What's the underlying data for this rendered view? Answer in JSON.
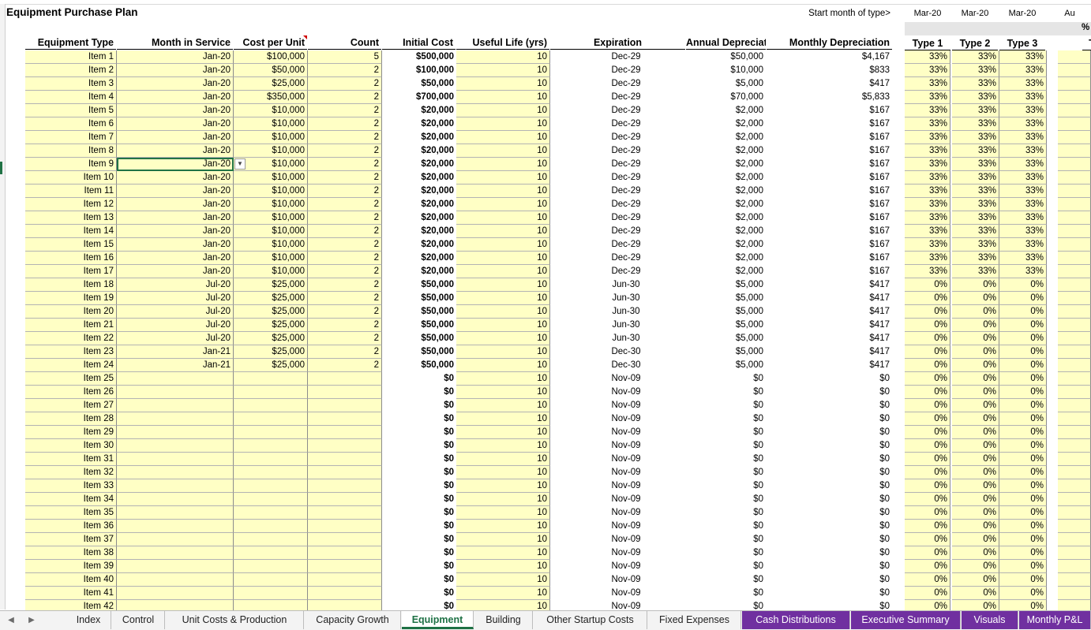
{
  "sheet": {
    "title": "Equipment Purchase Plan",
    "start_month_label": "Start month of type>",
    "start_months": [
      "Mar-20",
      "Mar-20",
      "Mar-20",
      "Au"
    ],
    "percent_label": "%",
    "headers": {
      "equipment_type": "Equipment Type",
      "month_in_service": "Month in Service",
      "cost_per_unit": "Cost per Unit",
      "count": "Count",
      "initial_cost": "Initial Cost",
      "useful_life": "Useful Life (yrs)",
      "expiration": "Expiration",
      "annual_depreciation": "Annual Depreciation",
      "monthly_depreciation": "Monthly Depreciation",
      "type1": "Type 1",
      "type2": "Type 2",
      "type3": "Type 3",
      "type4": "Ty"
    },
    "active_cell": "Month in Service, Item 9",
    "rows": [
      {
        "name": "Item 1",
        "month": "Jan-20",
        "cost": "$100,000",
        "count": "5",
        "initial": "$500,000",
        "life": "10",
        "exp": "Dec-29",
        "annual": "$50,000",
        "monthly": "$4,167",
        "t1": "33%",
        "t2": "33%",
        "t3": "33%"
      },
      {
        "name": "Item 2",
        "month": "Jan-20",
        "cost": "$50,000",
        "count": "2",
        "initial": "$100,000",
        "life": "10",
        "exp": "Dec-29",
        "annual": "$10,000",
        "monthly": "$833",
        "t1": "33%",
        "t2": "33%",
        "t3": "33%"
      },
      {
        "name": "Item 3",
        "month": "Jan-20",
        "cost": "$25,000",
        "count": "2",
        "initial": "$50,000",
        "life": "10",
        "exp": "Dec-29",
        "annual": "$5,000",
        "monthly": "$417",
        "t1": "33%",
        "t2": "33%",
        "t3": "33%"
      },
      {
        "name": "Item 4",
        "month": "Jan-20",
        "cost": "$350,000",
        "count": "2",
        "initial": "$700,000",
        "life": "10",
        "exp": "Dec-29",
        "annual": "$70,000",
        "monthly": "$5,833",
        "t1": "33%",
        "t2": "33%",
        "t3": "33%"
      },
      {
        "name": "Item 5",
        "month": "Jan-20",
        "cost": "$10,000",
        "count": "2",
        "initial": "$20,000",
        "life": "10",
        "exp": "Dec-29",
        "annual": "$2,000",
        "monthly": "$167",
        "t1": "33%",
        "t2": "33%",
        "t3": "33%"
      },
      {
        "name": "Item 6",
        "month": "Jan-20",
        "cost": "$10,000",
        "count": "2",
        "initial": "$20,000",
        "life": "10",
        "exp": "Dec-29",
        "annual": "$2,000",
        "monthly": "$167",
        "t1": "33%",
        "t2": "33%",
        "t3": "33%"
      },
      {
        "name": "Item 7",
        "month": "Jan-20",
        "cost": "$10,000",
        "count": "2",
        "initial": "$20,000",
        "life": "10",
        "exp": "Dec-29",
        "annual": "$2,000",
        "monthly": "$167",
        "t1": "33%",
        "t2": "33%",
        "t3": "33%"
      },
      {
        "name": "Item 8",
        "month": "Jan-20",
        "cost": "$10,000",
        "count": "2",
        "initial": "$20,000",
        "life": "10",
        "exp": "Dec-29",
        "annual": "$2,000",
        "monthly": "$167",
        "t1": "33%",
        "t2": "33%",
        "t3": "33%"
      },
      {
        "name": "Item 9",
        "month": "Jan-20",
        "cost": "$10,000",
        "count": "2",
        "initial": "$20,000",
        "life": "10",
        "exp": "Dec-29",
        "annual": "$2,000",
        "monthly": "$167",
        "t1": "33%",
        "t2": "33%",
        "t3": "33%"
      },
      {
        "name": "Item 10",
        "month": "Jan-20",
        "cost": "$10,000",
        "count": "2",
        "initial": "$20,000",
        "life": "10",
        "exp": "Dec-29",
        "annual": "$2,000",
        "monthly": "$167",
        "t1": "33%",
        "t2": "33%",
        "t3": "33%"
      },
      {
        "name": "Item 11",
        "month": "Jan-20",
        "cost": "$10,000",
        "count": "2",
        "initial": "$20,000",
        "life": "10",
        "exp": "Dec-29",
        "annual": "$2,000",
        "monthly": "$167",
        "t1": "33%",
        "t2": "33%",
        "t3": "33%"
      },
      {
        "name": "Item 12",
        "month": "Jan-20",
        "cost": "$10,000",
        "count": "2",
        "initial": "$20,000",
        "life": "10",
        "exp": "Dec-29",
        "annual": "$2,000",
        "monthly": "$167",
        "t1": "33%",
        "t2": "33%",
        "t3": "33%"
      },
      {
        "name": "Item 13",
        "month": "Jan-20",
        "cost": "$10,000",
        "count": "2",
        "initial": "$20,000",
        "life": "10",
        "exp": "Dec-29",
        "annual": "$2,000",
        "monthly": "$167",
        "t1": "33%",
        "t2": "33%",
        "t3": "33%"
      },
      {
        "name": "Item 14",
        "month": "Jan-20",
        "cost": "$10,000",
        "count": "2",
        "initial": "$20,000",
        "life": "10",
        "exp": "Dec-29",
        "annual": "$2,000",
        "monthly": "$167",
        "t1": "33%",
        "t2": "33%",
        "t3": "33%"
      },
      {
        "name": "Item 15",
        "month": "Jan-20",
        "cost": "$10,000",
        "count": "2",
        "initial": "$20,000",
        "life": "10",
        "exp": "Dec-29",
        "annual": "$2,000",
        "monthly": "$167",
        "t1": "33%",
        "t2": "33%",
        "t3": "33%"
      },
      {
        "name": "Item 16",
        "month": "Jan-20",
        "cost": "$10,000",
        "count": "2",
        "initial": "$20,000",
        "life": "10",
        "exp": "Dec-29",
        "annual": "$2,000",
        "monthly": "$167",
        "t1": "33%",
        "t2": "33%",
        "t3": "33%"
      },
      {
        "name": "Item 17",
        "month": "Jan-20",
        "cost": "$10,000",
        "count": "2",
        "initial": "$20,000",
        "life": "10",
        "exp": "Dec-29",
        "annual": "$2,000",
        "monthly": "$167",
        "t1": "33%",
        "t2": "33%",
        "t3": "33%"
      },
      {
        "name": "Item 18",
        "month": "Jul-20",
        "cost": "$25,000",
        "count": "2",
        "initial": "$50,000",
        "life": "10",
        "exp": "Jun-30",
        "annual": "$5,000",
        "monthly": "$417",
        "t1": "0%",
        "t2": "0%",
        "t3": "0%"
      },
      {
        "name": "Item 19",
        "month": "Jul-20",
        "cost": "$25,000",
        "count": "2",
        "initial": "$50,000",
        "life": "10",
        "exp": "Jun-30",
        "annual": "$5,000",
        "monthly": "$417",
        "t1": "0%",
        "t2": "0%",
        "t3": "0%"
      },
      {
        "name": "Item 20",
        "month": "Jul-20",
        "cost": "$25,000",
        "count": "2",
        "initial": "$50,000",
        "life": "10",
        "exp": "Jun-30",
        "annual": "$5,000",
        "monthly": "$417",
        "t1": "0%",
        "t2": "0%",
        "t3": "0%"
      },
      {
        "name": "Item 21",
        "month": "Jul-20",
        "cost": "$25,000",
        "count": "2",
        "initial": "$50,000",
        "life": "10",
        "exp": "Jun-30",
        "annual": "$5,000",
        "monthly": "$417",
        "t1": "0%",
        "t2": "0%",
        "t3": "0%"
      },
      {
        "name": "Item 22",
        "month": "Jul-20",
        "cost": "$25,000",
        "count": "2",
        "initial": "$50,000",
        "life": "10",
        "exp": "Jun-30",
        "annual": "$5,000",
        "monthly": "$417",
        "t1": "0%",
        "t2": "0%",
        "t3": "0%"
      },
      {
        "name": "Item 23",
        "month": "Jan-21",
        "cost": "$25,000",
        "count": "2",
        "initial": "$50,000",
        "life": "10",
        "exp": "Dec-30",
        "annual": "$5,000",
        "monthly": "$417",
        "t1": "0%",
        "t2": "0%",
        "t3": "0%"
      },
      {
        "name": "Item 24",
        "month": "Jan-21",
        "cost": "$25,000",
        "count": "2",
        "initial": "$50,000",
        "life": "10",
        "exp": "Dec-30",
        "annual": "$5,000",
        "monthly": "$417",
        "t1": "0%",
        "t2": "0%",
        "t3": "0%"
      },
      {
        "name": "Item 25",
        "month": "",
        "cost": "",
        "count": "",
        "initial": "$0",
        "life": "10",
        "exp": "Nov-09",
        "annual": "$0",
        "monthly": "$0",
        "t1": "0%",
        "t2": "0%",
        "t3": "0%"
      },
      {
        "name": "Item 26",
        "month": "",
        "cost": "",
        "count": "",
        "initial": "$0",
        "life": "10",
        "exp": "Nov-09",
        "annual": "$0",
        "monthly": "$0",
        "t1": "0%",
        "t2": "0%",
        "t3": "0%"
      },
      {
        "name": "Item 27",
        "month": "",
        "cost": "",
        "count": "",
        "initial": "$0",
        "life": "10",
        "exp": "Nov-09",
        "annual": "$0",
        "monthly": "$0",
        "t1": "0%",
        "t2": "0%",
        "t3": "0%"
      },
      {
        "name": "Item 28",
        "month": "",
        "cost": "",
        "count": "",
        "initial": "$0",
        "life": "10",
        "exp": "Nov-09",
        "annual": "$0",
        "monthly": "$0",
        "t1": "0%",
        "t2": "0%",
        "t3": "0%"
      },
      {
        "name": "Item 29",
        "month": "",
        "cost": "",
        "count": "",
        "initial": "$0",
        "life": "10",
        "exp": "Nov-09",
        "annual": "$0",
        "monthly": "$0",
        "t1": "0%",
        "t2": "0%",
        "t3": "0%"
      },
      {
        "name": "Item 30",
        "month": "",
        "cost": "",
        "count": "",
        "initial": "$0",
        "life": "10",
        "exp": "Nov-09",
        "annual": "$0",
        "monthly": "$0",
        "t1": "0%",
        "t2": "0%",
        "t3": "0%"
      },
      {
        "name": "Item 31",
        "month": "",
        "cost": "",
        "count": "",
        "initial": "$0",
        "life": "10",
        "exp": "Nov-09",
        "annual": "$0",
        "monthly": "$0",
        "t1": "0%",
        "t2": "0%",
        "t3": "0%"
      },
      {
        "name": "Item 32",
        "month": "",
        "cost": "",
        "count": "",
        "initial": "$0",
        "life": "10",
        "exp": "Nov-09",
        "annual": "$0",
        "monthly": "$0",
        "t1": "0%",
        "t2": "0%",
        "t3": "0%"
      },
      {
        "name": "Item 33",
        "month": "",
        "cost": "",
        "count": "",
        "initial": "$0",
        "life": "10",
        "exp": "Nov-09",
        "annual": "$0",
        "monthly": "$0",
        "t1": "0%",
        "t2": "0%",
        "t3": "0%"
      },
      {
        "name": "Item 34",
        "month": "",
        "cost": "",
        "count": "",
        "initial": "$0",
        "life": "10",
        "exp": "Nov-09",
        "annual": "$0",
        "monthly": "$0",
        "t1": "0%",
        "t2": "0%",
        "t3": "0%"
      },
      {
        "name": "Item 35",
        "month": "",
        "cost": "",
        "count": "",
        "initial": "$0",
        "life": "10",
        "exp": "Nov-09",
        "annual": "$0",
        "monthly": "$0",
        "t1": "0%",
        "t2": "0%",
        "t3": "0%"
      },
      {
        "name": "Item 36",
        "month": "",
        "cost": "",
        "count": "",
        "initial": "$0",
        "life": "10",
        "exp": "Nov-09",
        "annual": "$0",
        "monthly": "$0",
        "t1": "0%",
        "t2": "0%",
        "t3": "0%"
      },
      {
        "name": "Item 37",
        "month": "",
        "cost": "",
        "count": "",
        "initial": "$0",
        "life": "10",
        "exp": "Nov-09",
        "annual": "$0",
        "monthly": "$0",
        "t1": "0%",
        "t2": "0%",
        "t3": "0%"
      },
      {
        "name": "Item 38",
        "month": "",
        "cost": "",
        "count": "",
        "initial": "$0",
        "life": "10",
        "exp": "Nov-09",
        "annual": "$0",
        "monthly": "$0",
        "t1": "0%",
        "t2": "0%",
        "t3": "0%"
      },
      {
        "name": "Item 39",
        "month": "",
        "cost": "",
        "count": "",
        "initial": "$0",
        "life": "10",
        "exp": "Nov-09",
        "annual": "$0",
        "monthly": "$0",
        "t1": "0%",
        "t2": "0%",
        "t3": "0%"
      },
      {
        "name": "Item 40",
        "month": "",
        "cost": "",
        "count": "",
        "initial": "$0",
        "life": "10",
        "exp": "Nov-09",
        "annual": "$0",
        "monthly": "$0",
        "t1": "0%",
        "t2": "0%",
        "t3": "0%"
      },
      {
        "name": "Item 41",
        "month": "",
        "cost": "",
        "count": "",
        "initial": "$0",
        "life": "10",
        "exp": "Nov-09",
        "annual": "$0",
        "monthly": "$0",
        "t1": "0%",
        "t2": "0%",
        "t3": "0%"
      },
      {
        "name": "Item 42",
        "month": "",
        "cost": "",
        "count": "",
        "initial": "$0",
        "life": "10",
        "exp": "Nov-09",
        "annual": "$0",
        "monthly": "$0",
        "t1": "0%",
        "t2": "0%",
        "t3": "0%"
      }
    ]
  },
  "tabs": [
    {
      "label": "Index",
      "style": "normal"
    },
    {
      "label": "Control",
      "style": "normal"
    },
    {
      "label": "Unit Costs & Production",
      "style": "normal"
    },
    {
      "label": "Capacity Growth",
      "style": "normal"
    },
    {
      "label": "Equipment",
      "style": "active"
    },
    {
      "label": "Building",
      "style": "normal"
    },
    {
      "label": "Other Startup Costs",
      "style": "normal"
    },
    {
      "label": "Fixed Expenses",
      "style": "normal"
    },
    {
      "label": "Cash Distributions",
      "style": "purple"
    },
    {
      "label": "Executive Summary",
      "style": "purple"
    },
    {
      "label": "Visuals",
      "style": "purple"
    },
    {
      "label": "Monthly P&L",
      "style": "purple"
    }
  ],
  "colors": {
    "input_fill": "#ffffc5",
    "accent_green": "#217346",
    "tab_purple": "#7030a0",
    "comment_red": "#d00000"
  }
}
